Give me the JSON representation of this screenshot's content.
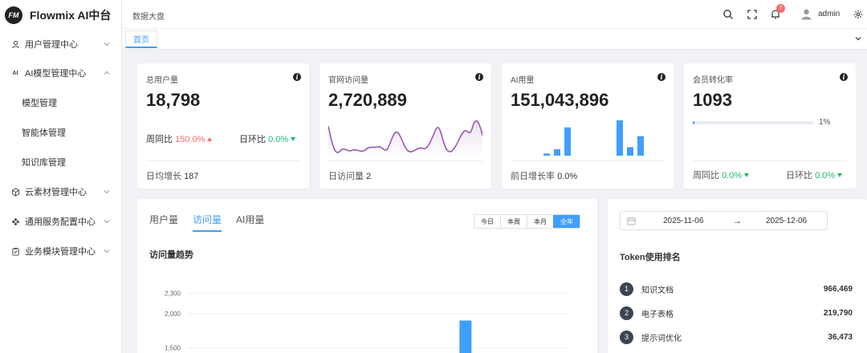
{
  "app": {
    "logo_mark": "FM",
    "title": "Flowmix AI中台"
  },
  "sidebar": {
    "items": [
      {
        "label": "用户管理中心",
        "icon": "user-icon",
        "expanded": false
      },
      {
        "label": "AI模型管理中心",
        "icon": "ai-icon",
        "expanded": true
      },
      {
        "label": "模型管理",
        "sub": true
      },
      {
        "label": "智能体管理",
        "sub": true
      },
      {
        "label": "知识库管理",
        "sub": true
      },
      {
        "label": "云素材管理中心",
        "icon": "cube-icon",
        "expanded": false
      },
      {
        "label": "通用服务配置中心",
        "icon": "grid-icon",
        "expanded": false
      },
      {
        "label": "业务模块管理中心",
        "icon": "clipboard-icon",
        "expanded": false
      }
    ]
  },
  "topbar": {
    "breadcrumb": "数据大盘",
    "notification_count": "7",
    "user": "admin"
  },
  "tabs": {
    "home": "首页"
  },
  "stats": {
    "total_users": {
      "title": "总用户量",
      "value": "18,798",
      "week_label": "周同比",
      "week_value": "150.0%",
      "day_label": "日环比",
      "day_value": "0.0%",
      "foot_label": "日均增长",
      "foot_value": "187"
    },
    "site_visits": {
      "title": "官网访问量",
      "value": "2,720,889",
      "foot_label": "日访问量",
      "foot_value": "2"
    },
    "ai_usage": {
      "title": "AI用量",
      "value": "151,043,896",
      "foot_label": "前日增长率",
      "foot_value": "0.0%",
      "bars": [
        0.06,
        0.18,
        0.8,
        0,
        0,
        0,
        0,
        1.0,
        0.24,
        0.55
      ]
    },
    "conversion": {
      "title": "会员转化率",
      "value": "1093",
      "progress_percent": 1,
      "progress_label": "1%",
      "week_label": "周同比",
      "week_value": "0.0%",
      "day_label": "日环比",
      "day_value": "0.0%"
    }
  },
  "trend": {
    "tabs": [
      "用户量",
      "访问量",
      "AI用量"
    ],
    "active_tab": 1,
    "ranges": [
      "今日",
      "本周",
      "本月",
      "全年"
    ],
    "active_range": 3,
    "title": "访问量趋势"
  },
  "chart_data": {
    "type": "bar",
    "title": "访问量趋势",
    "yticks": [
      "2,300",
      "2,000",
      "1,500"
    ],
    "ylim": [
      1000,
      2300
    ],
    "bars": [
      {
        "index": 8,
        "value": 1900
      }
    ],
    "category_count": 12
  },
  "ranking": {
    "date_start": "2025-11-06",
    "date_arrow": "→",
    "date_end": "2025-12-06",
    "title": "Token使用排名",
    "items": [
      {
        "rank": "1",
        "name": "知识文档",
        "value": "966,469"
      },
      {
        "rank": "2",
        "name": "电子表格",
        "value": "219,790"
      },
      {
        "rank": "3",
        "name": "提示词优化",
        "value": "36,473"
      }
    ]
  },
  "colors": {
    "accent": "#409eff",
    "up": "#f56c6c",
    "down": "#19be6b",
    "line": "#9b59b6"
  }
}
